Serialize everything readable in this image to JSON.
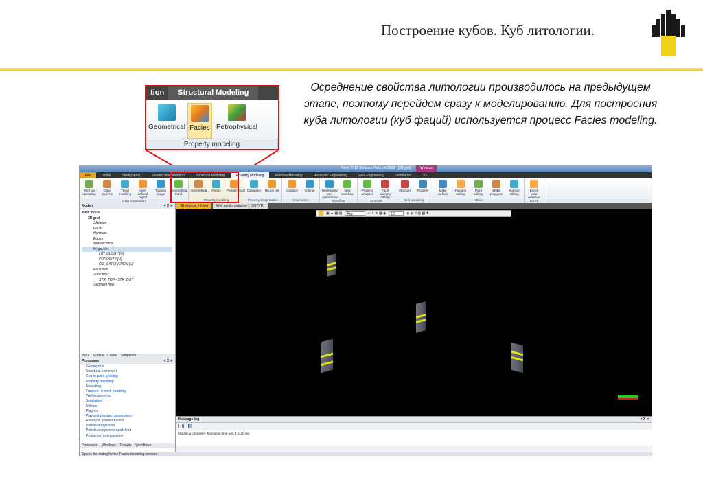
{
  "slide": {
    "title": "Построение кубов. Куб литологии.",
    "description": "Осреднение свойства литологии производилось на предыдущем этапе, поэтому перейдем сразу к моделированию. Для построения куба литологии (куб фаций) используется процесс Facies modeling."
  },
  "inset": {
    "tab_prev": "tion",
    "tab_active": "Structural Modeling",
    "buttons": [
      "Geometrical",
      "Facies",
      "Petrophysical"
    ],
    "group": "Property modeling"
  },
  "app": {
    "title": "Petrel 2013 Software Platform 2013 - [3D grid]",
    "window_tab": "Window",
    "tabs": [
      "File",
      "Home",
      "Stratigraphy",
      "Seismic Interpretation",
      "Structural Modeling",
      "Property Modeling",
      "Fracture Modeling",
      "Reservoir Engineering",
      "Well Engineering",
      "Simulation",
      "3D"
    ],
    "ribbon_groups": [
      {
        "label": "Data preparation",
        "buttons": [
          "Well log upscaling",
          "Data analysis",
          "Trend modeling",
          "User-defined object",
          "Training image",
          "Geometrical trend"
        ]
      },
      {
        "label": "Property modeling",
        "buttons": [
          "Geometrical",
          "Facies",
          "Petrophysical"
        ]
      },
      {
        "label": "Property interpretation",
        "buttons": [
          "Calculator",
          "Neural net"
        ]
      },
      {
        "label": "Volumetrics",
        "buttons": [
          "Contacts",
          "Volume"
        ]
      },
      {
        "label": "Workflow",
        "buttons": [
          "Uncertainty and optimization",
          "New workflow"
        ]
      },
      {
        "label": "Structure",
        "buttons": [
          "Property analyzer",
          "Fault property editing"
        ]
      },
      {
        "label": "Grid upscaling",
        "buttons": [
          "Structure",
          "Property"
        ]
      },
      {
        "label": "Utilities",
        "buttons": [
          "Make surface",
          "Polygon editing",
          "Point editing",
          "Make polygons",
          "Surface editing"
        ]
      },
      {
        "label": "Enrich",
        "buttons": [
          "Enrich your workflow"
        ]
      }
    ],
    "models_panel": {
      "title": "Models",
      "items": [
        "New model",
        "3D grid",
        "Skeleton",
        "Faults",
        "Horizons",
        "Edges",
        "Intersections",
        "Properties",
        "LITHOLOGY [U]",
        "POROSITY [U]",
        "OIL_SATURATION [U]",
        "Fault filter",
        "Zone filter",
        "STR_TOP - STR_BOT",
        "Segment filter"
      ]
    },
    "left_tabs": [
      "Input",
      "Models",
      "Cases",
      "Templates"
    ],
    "processes_panel": {
      "title": "Processes",
      "items": [
        "Geophysics",
        "Structural framework",
        "Corner point gridding",
        "Property modeling",
        "Upscaling",
        "Fracture network modeling",
        "Well engineering",
        "Simulation",
        "Utilities",
        "Plug-ins",
        "Play and prospect assessment",
        "Reservoir geomechanics",
        "Petroleum systems",
        "Petroleum systems quick look",
        "Production interpretation"
      ]
    },
    "bottom_tabs": [
      "Processes",
      "Windows",
      "Results",
      "Workflows"
    ],
    "view_tabs": [
      "3D window 1 [dev]",
      "Well section window 1 [SSTVD]"
    ],
    "toolbar": {
      "dropdown": "Any",
      "zoom": "10"
    },
    "message_log": {
      "title": "Message log",
      "text": "Modeling complete - Execution time was 3.5420 sec"
    },
    "status": "Opens the dialog for the Facies modeling process"
  },
  "colors": {
    "highlight": "#dd1111",
    "rule": "#e8c63a",
    "facies_yellow": "#e6e11d"
  }
}
